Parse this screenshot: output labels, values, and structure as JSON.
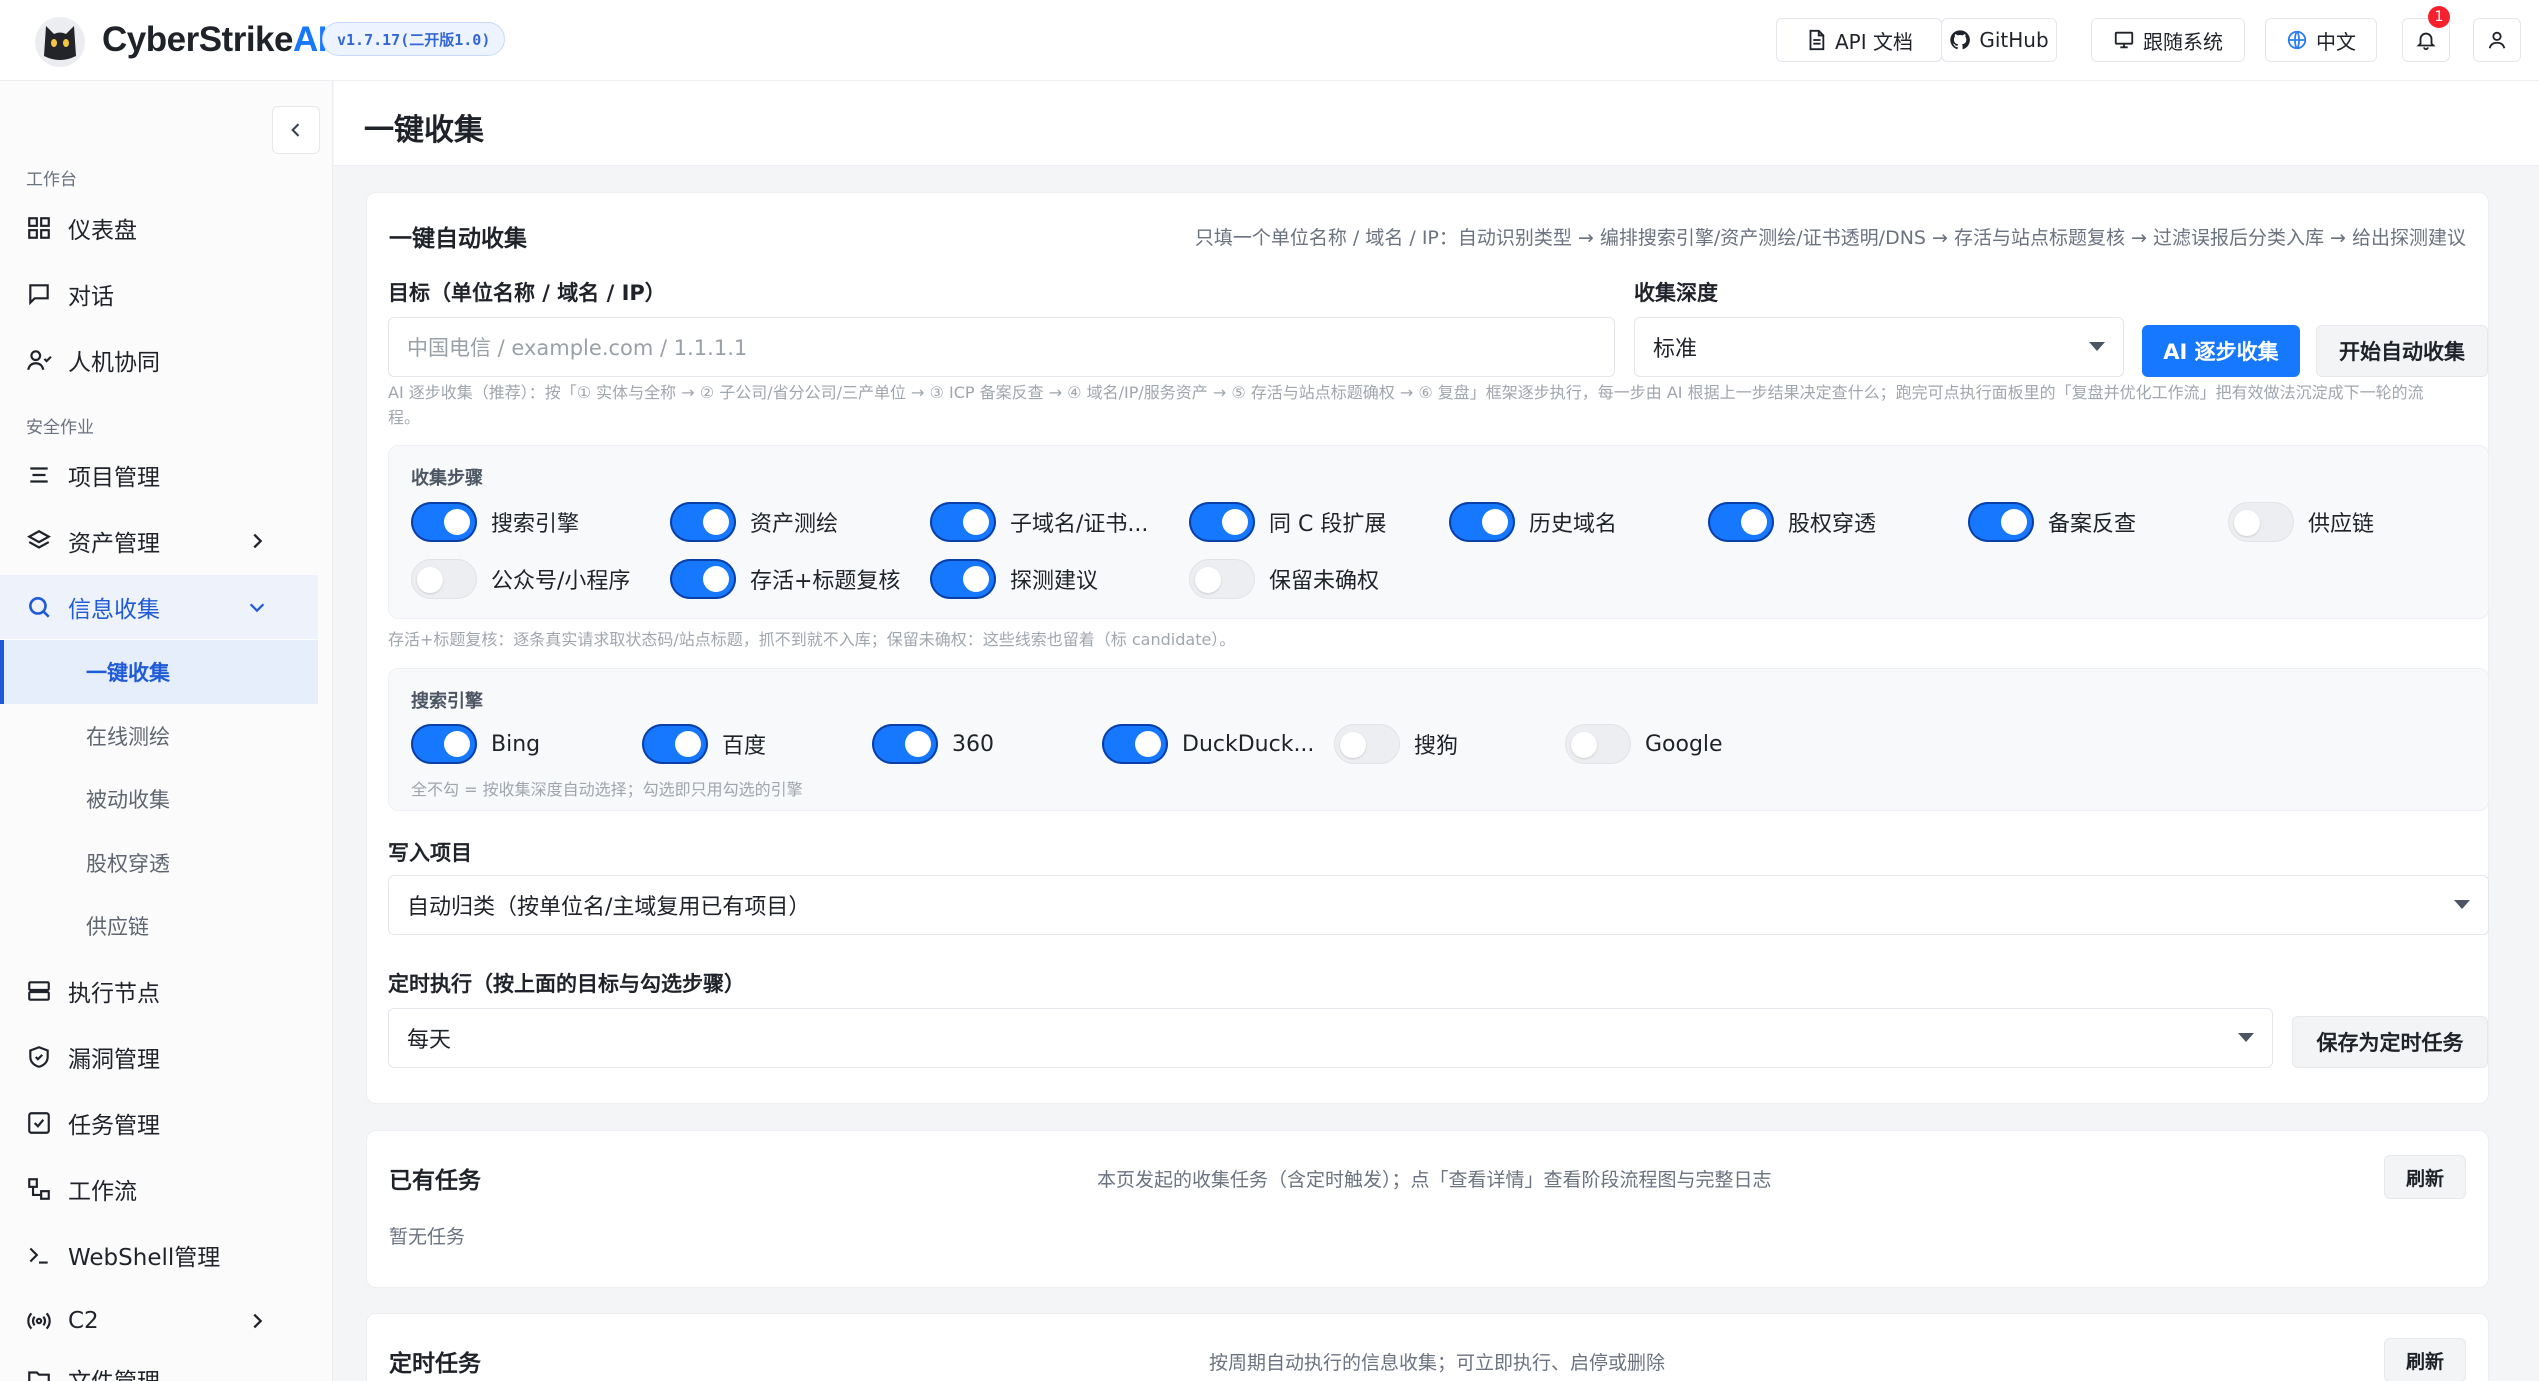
{
  "header": {
    "brand_main": "CyberStrike",
    "brand_ai": "AI",
    "version": "v1.7.17(二开版1.0)",
    "api_docs": "API 文档",
    "github": "GitHub",
    "follow_system": "跟随系统",
    "language": "中文",
    "notification_count": "1"
  },
  "sidebar": {
    "section_workbench": "工作台",
    "section_security": "安全作业",
    "items": {
      "dashboard": "仪表盘",
      "chat": "对话",
      "human_machine": "人机协同",
      "projects": "项目管理",
      "assets": "资产管理",
      "info_collection": "信息收集",
      "exec_nodes": "执行节点",
      "vulns": "漏洞管理",
      "tasks": "任务管理",
      "workflow": "工作流",
      "webshell": "WebShell管理",
      "c2": "C2",
      "files": "文件管理"
    },
    "sub_items": {
      "one_click": "一键收集",
      "online_mapping": "在线测绘",
      "passive": "被动收集",
      "equity": "股权穿透",
      "supply_chain": "供应链"
    }
  },
  "page": {
    "title": "一键收集"
  },
  "auto_collect": {
    "title": "一键自动收集",
    "desc": "只填一个单位名称 / 域名 / IP：自动识别类型 → 编排搜索引擎/资产测绘/证书透明/DNS → 存活与站点标题复核 → 过滤误报后分类入库 → 给出探测建议",
    "target_label": "目标（单位名称 / 域名 / IP）",
    "target_placeholder": "中国电信 / example.com / 1.1.1.1",
    "depth_label": "收集深度",
    "depth_value": "标准",
    "ai_button": "AI 逐步收集",
    "start_button": "开始自动收集",
    "hint_line1": "AI 逐步收集（推荐）：按「① 实体与全称 → ② 子公司/省分公司/三产单位 → ③ ICP 备案反查 → ④ 域名/IP/服务资产 → ⑤ 存活与站点标题确权 → ⑥ 复盘」框架逐步执行，每一步由 AI 根据上一步结果决定查什么；跑完可点执行面板里的「复盘并优化工作流」把有效做法沉淀成下一轮的流",
    "hint_line2": "程。",
    "steps_label": "收集步骤",
    "steps": [
      {
        "label": "搜索引擎",
        "on": true
      },
      {
        "label": "资产测绘",
        "on": true
      },
      {
        "label": "子域名/证书...",
        "on": true
      },
      {
        "label": "同 C 段扩展",
        "on": true
      },
      {
        "label": "历史域名",
        "on": true
      },
      {
        "label": "股权穿透",
        "on": true
      },
      {
        "label": "备案反查",
        "on": true
      },
      {
        "label": "供应链",
        "on": false
      },
      {
        "label": "公众号/小程序",
        "on": false
      },
      {
        "label": "存活+标题复核",
        "on": true
      },
      {
        "label": "探测建议",
        "on": true
      },
      {
        "label": "保留未确权",
        "on": false
      }
    ],
    "steps_hint": "存活+标题复核：逐条真实请求取状态码/站点标题，抓不到就不入库；保留未确权：这些线索也留着（标 candidate）。",
    "engines_label": "搜索引擎",
    "engines": [
      {
        "label": "Bing",
        "on": true
      },
      {
        "label": "百度",
        "on": true
      },
      {
        "label": "360",
        "on": true
      },
      {
        "label": "DuckDuck...",
        "on": true
      },
      {
        "label": "搜狗",
        "on": false
      },
      {
        "label": "Google",
        "on": false
      }
    ],
    "engines_hint": "全不勾 = 按收集深度自动选择；勾选即只用勾选的引擎",
    "project_label": "写入项目",
    "project_value": "自动归类（按单位名/主域复用已有项目）",
    "schedule_label": "定时执行（按上面的目标与勾选步骤）",
    "schedule_value": "每天",
    "save_schedule": "保存为定时任务"
  },
  "existing_tasks": {
    "title": "已有任务",
    "desc": "本页发起的收集任务（含定时触发）；点「查看详情」查看阶段流程图与完整日志",
    "refresh": "刷新",
    "empty": "暂无任务"
  },
  "scheduled_tasks": {
    "title": "定时任务",
    "desc": "按周期自动执行的信息收集；可立即执行、启停或删除",
    "refresh": "刷新"
  }
}
